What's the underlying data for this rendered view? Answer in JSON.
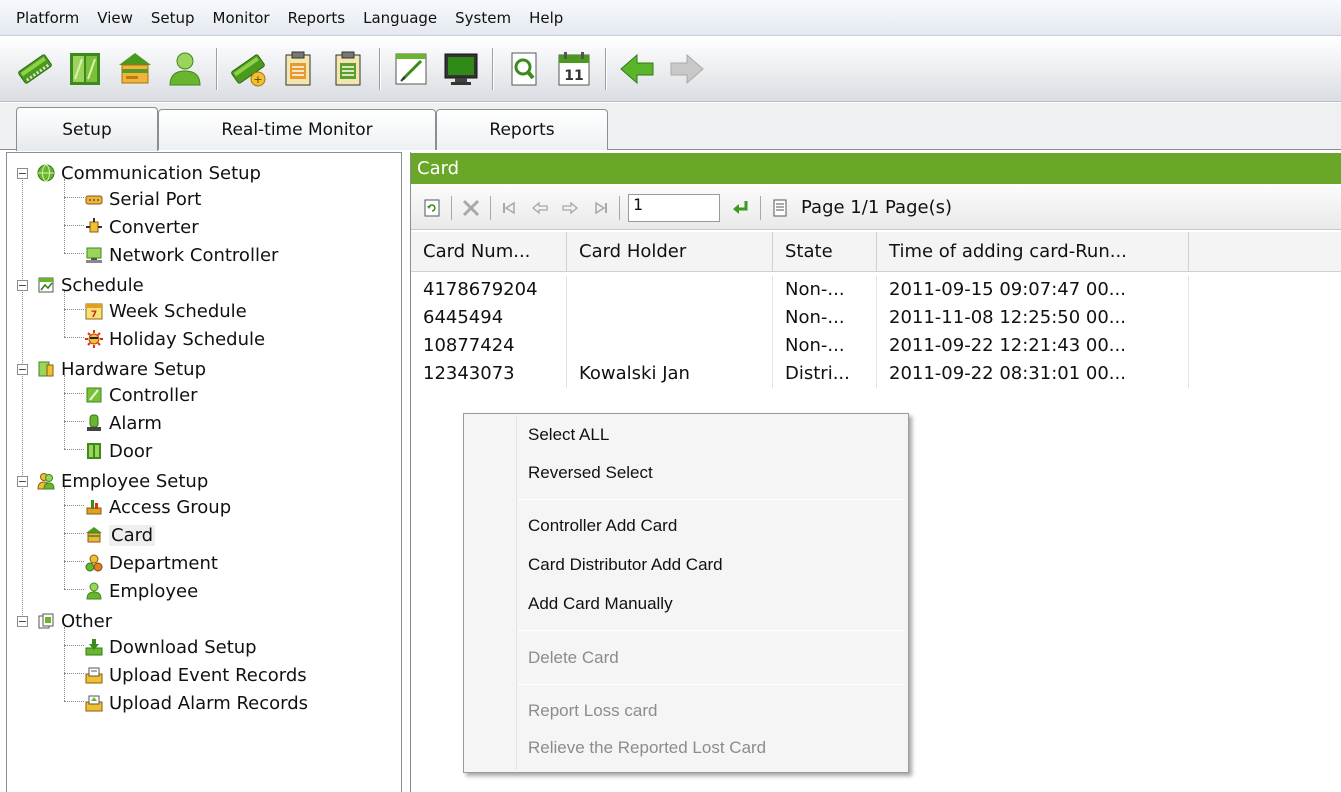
{
  "menu": [
    "Platform",
    "View",
    "Setup",
    "Monitor",
    "Reports",
    "Language",
    "System",
    "Help"
  ],
  "toolbar": {
    "icons": [
      "controller-card-icon",
      "door-icon",
      "card-icon",
      "employee-icon",
      "controller-add-icon",
      "report-icon",
      "report2-icon",
      "edit-icon",
      "monitor-icon",
      "search-doc-icon",
      "calendar-icon",
      "back-arrow-icon",
      "forward-arrow-icon"
    ],
    "calendar_day": "11"
  },
  "tabs": [
    "Setup",
    "Real-time Monitor",
    "Reports"
  ],
  "tree": {
    "groups": [
      {
        "label": "Communication Setup",
        "children": [
          "Serial Port",
          "Converter",
          "Network Controller"
        ]
      },
      {
        "label": "Schedule",
        "children": [
          "Week Schedule",
          "Holiday Schedule"
        ]
      },
      {
        "label": "Hardware Setup",
        "children": [
          "Controller",
          "Alarm",
          "Door"
        ]
      },
      {
        "label": "Employee Setup",
        "children": [
          "Access Group",
          "Card",
          "Department",
          "Employee"
        ]
      },
      {
        "label": "Other",
        "children": [
          "Download Setup",
          "Upload Event Records",
          "Upload Alarm Records"
        ]
      }
    ],
    "expand_symbol": "−"
  },
  "panel": {
    "title": "Card",
    "page_input": "1",
    "page_info": "Page 1/1 Page(s)"
  },
  "grid": {
    "columns": [
      "Card Num...",
      "Card Holder",
      "State",
      "Time of adding card-Run..."
    ],
    "rows": [
      [
        "4178679204",
        "",
        "Non-...",
        "2011-09-15 09:07:47 00..."
      ],
      [
        "6445494",
        "",
        "Non-...",
        "2011-11-08 12:25:50 00..."
      ],
      [
        "10877424",
        "",
        "Non-...",
        "2011-09-22 12:21:43 00..."
      ],
      [
        "12343073",
        "Kowalski Jan",
        "Distri...",
        "2011-09-22 08:31:01 00..."
      ]
    ]
  },
  "context_menu": {
    "items": [
      {
        "label": "Select ALL",
        "enabled": true
      },
      {
        "label": "Reversed Select",
        "enabled": true
      },
      {
        "label": "Controller Add Card",
        "enabled": true
      },
      {
        "label": "Card Distributor Add Card",
        "enabled": true
      },
      {
        "label": "Add Card Manually",
        "enabled": true
      },
      {
        "label": "Delete Card",
        "enabled": false
      },
      {
        "label": "Report Loss card",
        "enabled": false
      },
      {
        "label": "Relieve the Reported Lost Card",
        "enabled": false
      }
    ]
  },
  "colors": {
    "accent_green": "#6aa628"
  }
}
